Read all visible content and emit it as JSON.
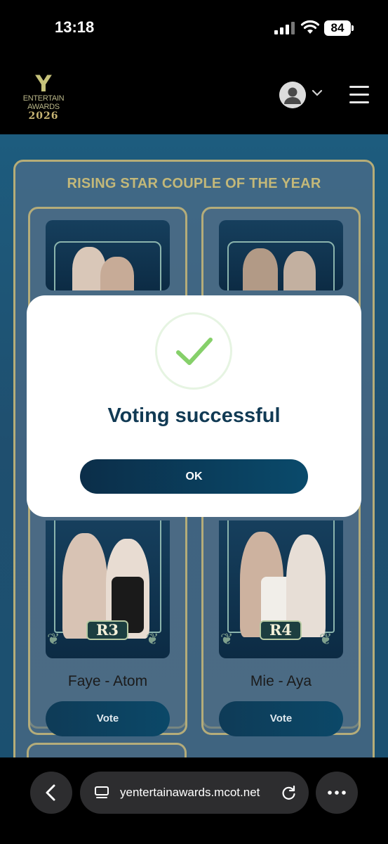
{
  "status_bar": {
    "time": "13:18",
    "battery": "84"
  },
  "header": {
    "logo": {
      "letter": "Y",
      "line1": "ENTERTAIN",
      "line2": "AWARDS",
      "year": "2026"
    },
    "icons": {
      "avatar": "user-icon",
      "dropdown": "chevron-down-icon",
      "menu": "hamburger-menu-icon"
    }
  },
  "category": {
    "title": "RISING STAR COUPLE OF THE YEAR",
    "nominees": [
      {
        "code": "R3",
        "name": "Faye - Atom",
        "vote_label": "Vote"
      },
      {
        "code": "R4",
        "name": "Mie - Aya",
        "vote_label": "Vote"
      }
    ]
  },
  "modal": {
    "icon": "checkmark-icon",
    "title": "Voting successful",
    "ok_label": "OK"
  },
  "browser": {
    "url": "yentertainawards.mcot.net",
    "icons": {
      "back": "back-arrow-icon",
      "tabs": "tabs-icon",
      "reload": "reload-icon",
      "more": "more-icon"
    }
  },
  "colors": {
    "accent_gold": "#b6ad78",
    "page_blue": "#1f5677",
    "button_navy": "#0b3a56",
    "check_green": "#86d06a"
  }
}
